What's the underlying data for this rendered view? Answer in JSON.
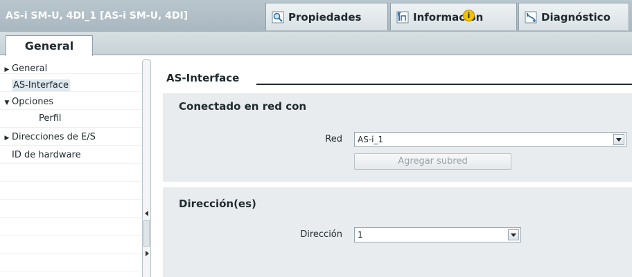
{
  "window": {
    "title": "AS-i SM-U, 4DI_1 [AS-i SM-U, 4DI]",
    "tabs": [
      {
        "label": "Propiedades",
        "icon": "magnifier-icon"
      },
      {
        "label": "Información",
        "icon": "info-pointer-icon",
        "badge": "i"
      },
      {
        "label": "Diagnóstico",
        "icon": "diagnostics-icon"
      }
    ]
  },
  "subtabs": [
    {
      "label": "General"
    }
  ],
  "nav": {
    "items": [
      {
        "label": "General",
        "arrow": "▶"
      },
      {
        "label": "AS-Interface",
        "arrow": ""
      },
      {
        "label": "Opciones",
        "arrow": "▼"
      },
      {
        "label": "Perfil",
        "arrow": ""
      },
      {
        "label": "Direcciones de E/S",
        "arrow": "▶"
      },
      {
        "label": "ID de hardware",
        "arrow": ""
      }
    ]
  },
  "main": {
    "section_title": "AS-Interface",
    "network": {
      "title": "Conectado en red con",
      "red_label": "Red",
      "red_value": "AS-i_1",
      "add_subnet_label": "Agregar subred"
    },
    "address": {
      "title": "Dirección(es)",
      "direccion_label": "Dirección",
      "direccion_value": "1"
    }
  },
  "colors": {
    "titlebar": "#b9c6ce",
    "panel": "#e9ecee",
    "selected_nav": "#dfe8ee",
    "info_badge": "#f2c200"
  }
}
